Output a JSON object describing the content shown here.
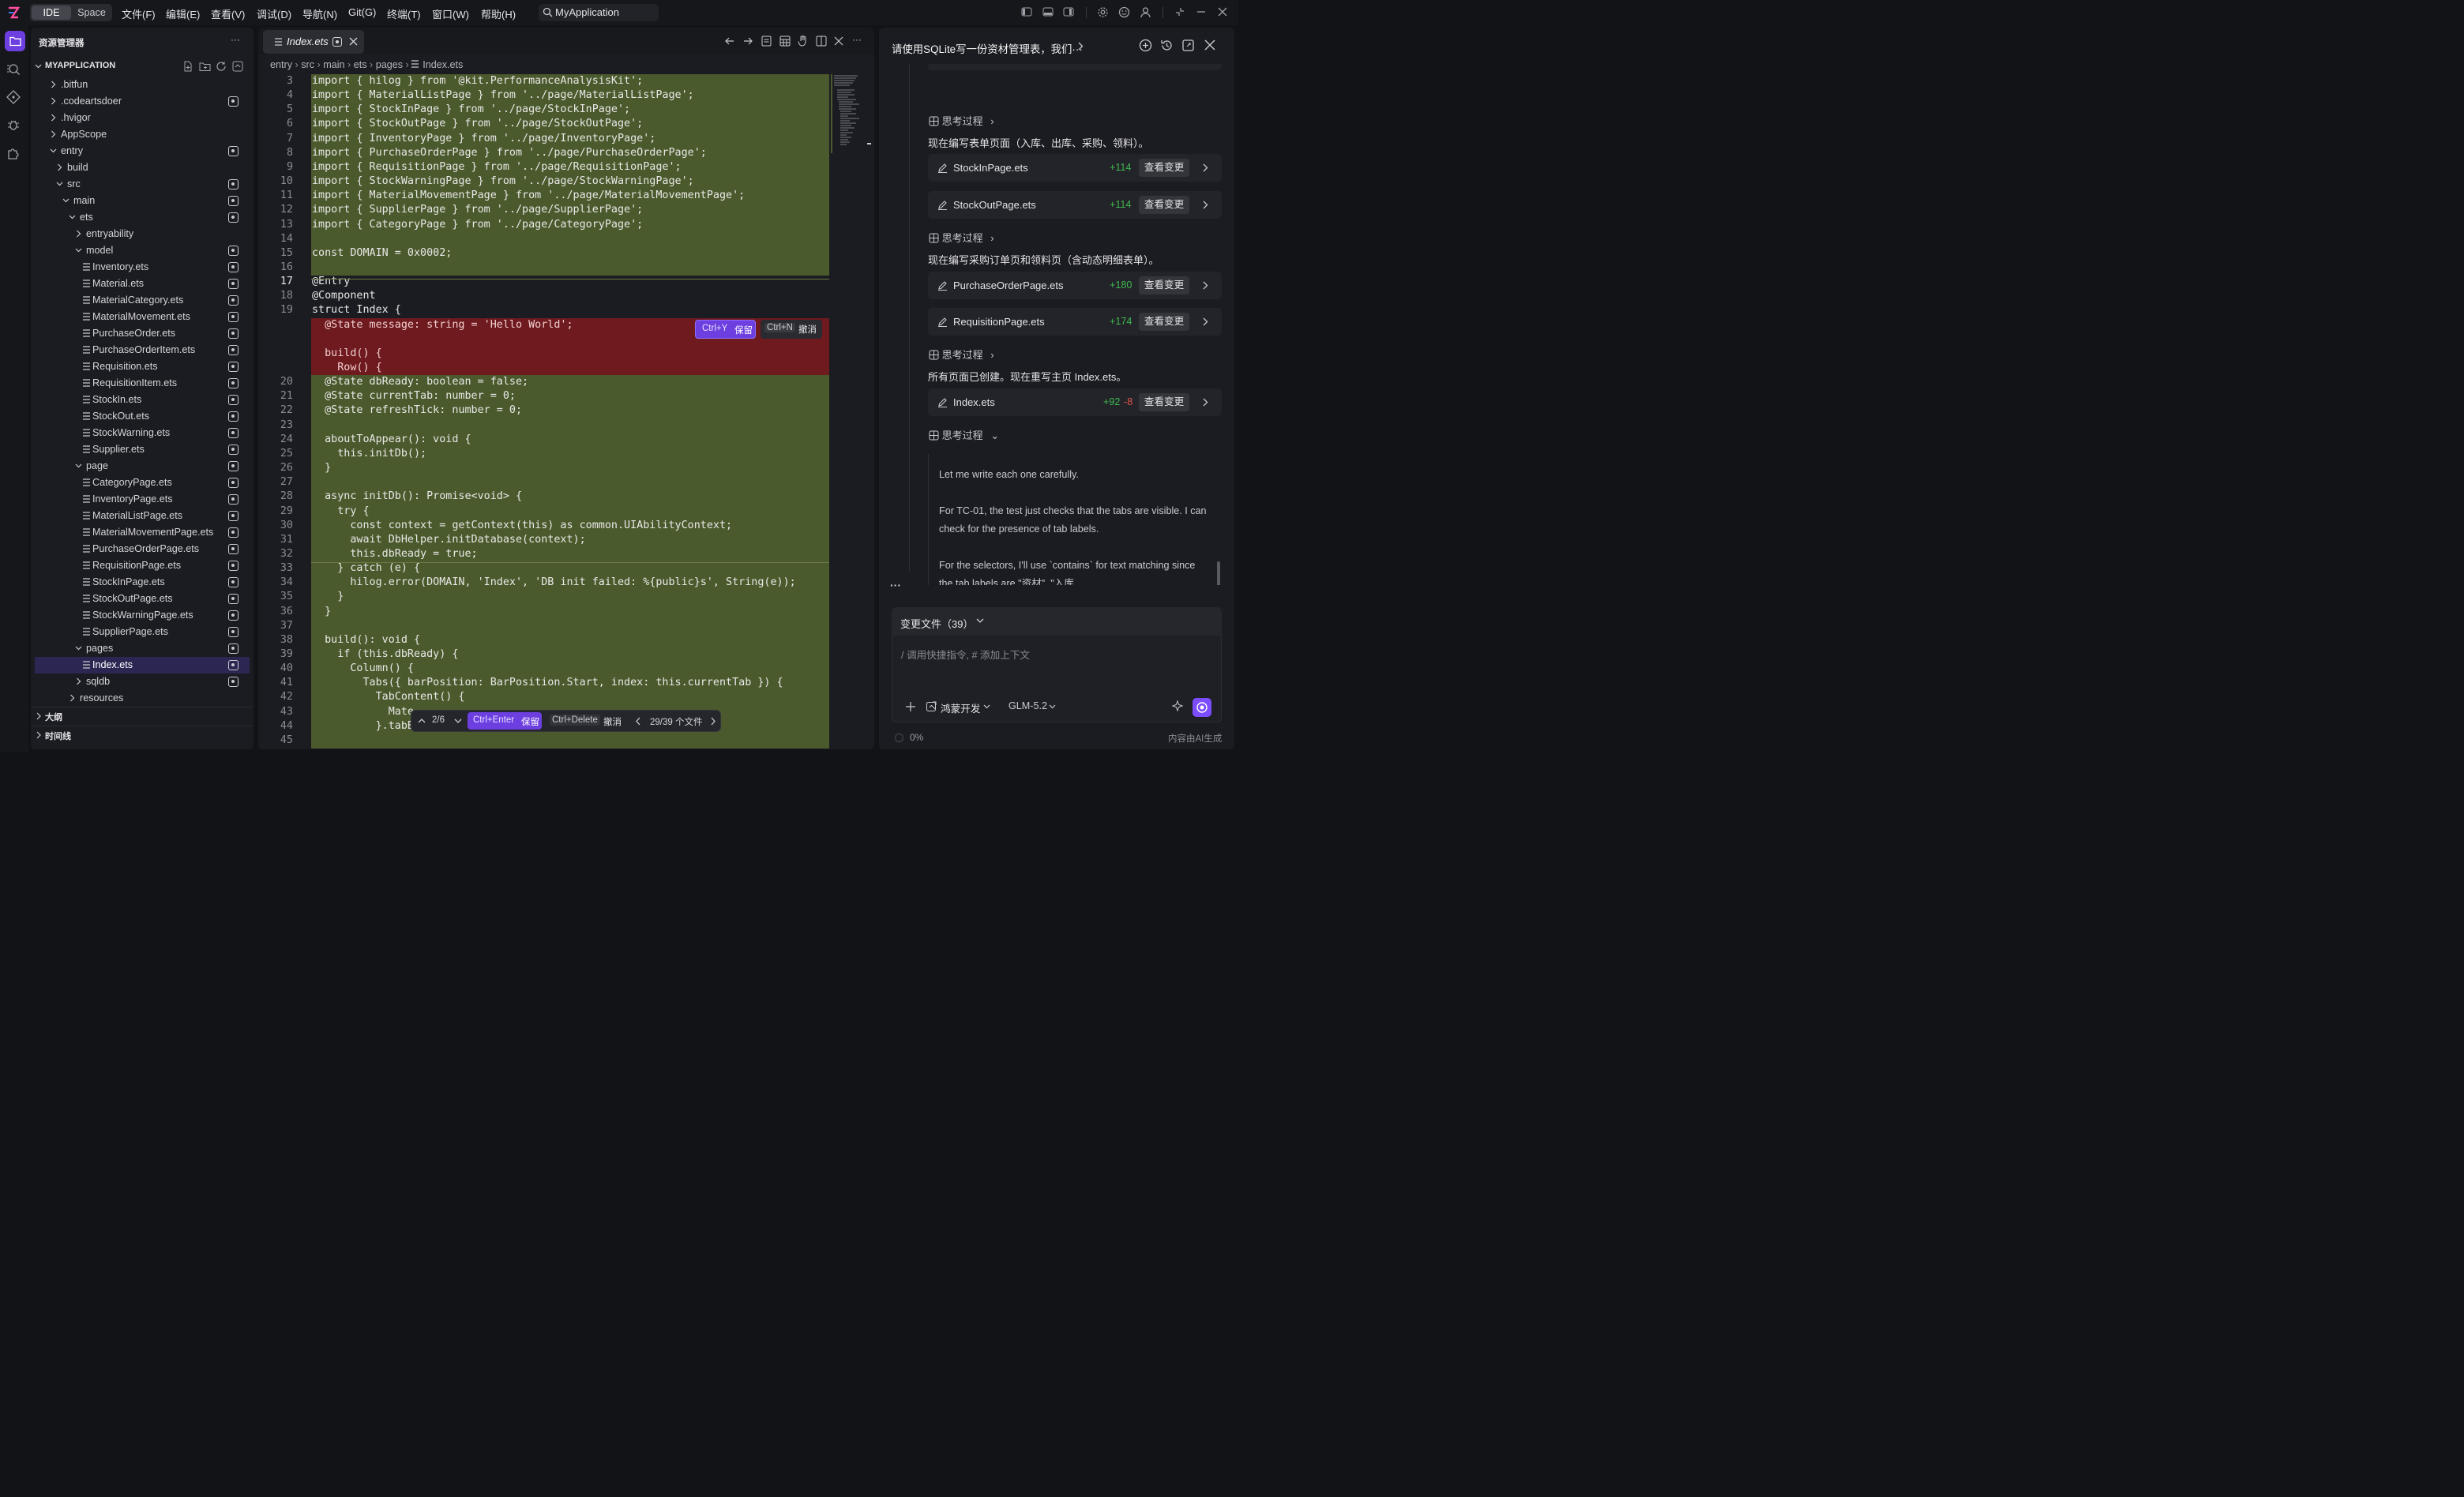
{
  "titlebar": {
    "mode_ide": "IDE",
    "mode_space": "Space",
    "menus": [
      "文件(F)",
      "编辑(E)",
      "查看(V)",
      "调试(D)",
      "导航(N)",
      "Git(G)",
      "终端(T)",
      "窗口(W)",
      "帮助(H)"
    ],
    "search_text": "MyApplication"
  },
  "explorer": {
    "title": "资源管理器",
    "more": "···",
    "project": "MYAPPLICATION",
    "items": [
      {
        "label": ".bitfun",
        "depth": 0,
        "type": "folder",
        "open": false,
        "dot": false
      },
      {
        "label": ".codeartsdoer",
        "depth": 0,
        "type": "folder",
        "open": false,
        "dot": true
      },
      {
        "label": ".hvigor",
        "depth": 0,
        "type": "folder",
        "open": false,
        "dot": false
      },
      {
        "label": "AppScope",
        "depth": 0,
        "type": "folder",
        "open": false,
        "dot": false
      },
      {
        "label": "entry",
        "depth": 0,
        "type": "folder",
        "open": true,
        "dot": true
      },
      {
        "label": "build",
        "depth": 1,
        "type": "folder",
        "open": false,
        "dot": false
      },
      {
        "label": "src",
        "depth": 1,
        "type": "folder",
        "open": true,
        "dot": true
      },
      {
        "label": "main",
        "depth": 2,
        "type": "folder",
        "open": true,
        "dot": true
      },
      {
        "label": "ets",
        "depth": 3,
        "type": "folder",
        "open": true,
        "dot": true
      },
      {
        "label": "entryability",
        "depth": 4,
        "type": "folder",
        "open": false,
        "dot": false
      },
      {
        "label": "model",
        "depth": 4,
        "type": "folder",
        "open": true,
        "dot": true
      },
      {
        "label": "Inventory.ets",
        "depth": 5,
        "type": "file",
        "dot": true
      },
      {
        "label": "Material.ets",
        "depth": 5,
        "type": "file",
        "dot": true
      },
      {
        "label": "MaterialCategory.ets",
        "depth": 5,
        "type": "file",
        "dot": true
      },
      {
        "label": "MaterialMovement.ets",
        "depth": 5,
        "type": "file",
        "dot": true
      },
      {
        "label": "PurchaseOrder.ets",
        "depth": 5,
        "type": "file",
        "dot": true
      },
      {
        "label": "PurchaseOrderItem.ets",
        "depth": 5,
        "type": "file",
        "dot": true
      },
      {
        "label": "Requisition.ets",
        "depth": 5,
        "type": "file",
        "dot": true
      },
      {
        "label": "RequisitionItem.ets",
        "depth": 5,
        "type": "file",
        "dot": true
      },
      {
        "label": "StockIn.ets",
        "depth": 5,
        "type": "file",
        "dot": true
      },
      {
        "label": "StockOut.ets",
        "depth": 5,
        "type": "file",
        "dot": true
      },
      {
        "label": "StockWarning.ets",
        "depth": 5,
        "type": "file",
        "dot": true
      },
      {
        "label": "Supplier.ets",
        "depth": 5,
        "type": "file",
        "dot": true
      },
      {
        "label": "page",
        "depth": 4,
        "type": "folder",
        "open": true,
        "dot": true
      },
      {
        "label": "CategoryPage.ets",
        "depth": 5,
        "type": "file",
        "dot": true
      },
      {
        "label": "InventoryPage.ets",
        "depth": 5,
        "type": "file",
        "dot": true
      },
      {
        "label": "MaterialListPage.ets",
        "depth": 5,
        "type": "file",
        "dot": true
      },
      {
        "label": "MaterialMovementPage.ets",
        "depth": 5,
        "type": "file",
        "dot": true
      },
      {
        "label": "PurchaseOrderPage.ets",
        "depth": 5,
        "type": "file",
        "dot": true
      },
      {
        "label": "RequisitionPage.ets",
        "depth": 5,
        "type": "file",
        "dot": true
      },
      {
        "label": "StockInPage.ets",
        "depth": 5,
        "type": "file",
        "dot": true
      },
      {
        "label": "StockOutPage.ets",
        "depth": 5,
        "type": "file",
        "dot": true
      },
      {
        "label": "StockWarningPage.ets",
        "depth": 5,
        "type": "file",
        "dot": true
      },
      {
        "label": "SupplierPage.ets",
        "depth": 5,
        "type": "file",
        "dot": true
      },
      {
        "label": "pages",
        "depth": 4,
        "type": "folder",
        "open": true,
        "dot": true
      },
      {
        "label": "Index.ets",
        "depth": 5,
        "type": "file",
        "dot": true,
        "selected": true
      },
      {
        "label": "sqldb",
        "depth": 4,
        "type": "folder",
        "open": false,
        "dot": true
      },
      {
        "label": "resources",
        "depth": 3,
        "type": "folder",
        "open": false,
        "dot": false
      }
    ],
    "outline": "大纲",
    "timeline": "时间线"
  },
  "editor": {
    "tab_label": "Index.ets",
    "breadcrumb": [
      "entry",
      "src",
      "main",
      "ets",
      "pages",
      "Index.ets"
    ],
    "lines": [
      {
        "n": "3",
        "t": "import { hilog } from '@kit.PerformanceAnalysisKit';",
        "k": "add"
      },
      {
        "n": "4",
        "t": "import { MaterialListPage } from '../page/MaterialListPage';",
        "k": "add"
      },
      {
        "n": "5",
        "t": "import { StockInPage } from '../page/StockInPage';",
        "k": "add"
      },
      {
        "n": "6",
        "t": "import { StockOutPage } from '../page/StockOutPage';",
        "k": "add"
      },
      {
        "n": "7",
        "t": "import { InventoryPage } from '../page/InventoryPage';",
        "k": "add"
      },
      {
        "n": "8",
        "t": "import { PurchaseOrderPage } from '../page/PurchaseOrderPage';",
        "k": "add"
      },
      {
        "n": "9",
        "t": "import { RequisitionPage } from '../page/RequisitionPage';",
        "k": "add"
      },
      {
        "n": "10",
        "t": "import { StockWarningPage } from '../page/StockWarningPage';",
        "k": "add"
      },
      {
        "n": "11",
        "t": "import { MaterialMovementPage } from '../page/MaterialMovementPage';",
        "k": "add"
      },
      {
        "n": "12",
        "t": "import { SupplierPage } from '../page/SupplierPage';",
        "k": "add"
      },
      {
        "n": "13",
        "t": "import { CategoryPage } from '../page/CategoryPage';",
        "k": "add"
      },
      {
        "n": "14",
        "t": "",
        "k": "add"
      },
      {
        "n": "15",
        "t": "const DOMAIN = 0x0002;",
        "k": "add"
      },
      {
        "n": "16",
        "t": "",
        "k": "add"
      },
      {
        "n": "17",
        "t": "@Entry",
        "k": "ctx"
      },
      {
        "n": "18",
        "t": "@Component",
        "k": "ctx"
      },
      {
        "n": "19",
        "t": "struct Index {",
        "k": "ctx"
      },
      {
        "n": "",
        "t": "  @State message: string = 'Hello World';",
        "k": "del"
      },
      {
        "n": "",
        "t": "",
        "k": "del"
      },
      {
        "n": "",
        "t": "  build() {",
        "k": "del"
      },
      {
        "n": "",
        "t": "    Row() {",
        "k": "del"
      },
      {
        "n": "20",
        "t": "  @State dbReady: boolean = false;",
        "k": "add"
      },
      {
        "n": "21",
        "t": "  @State currentTab: number = 0;",
        "k": "add"
      },
      {
        "n": "22",
        "t": "  @State refreshTick: number = 0;",
        "k": "add"
      },
      {
        "n": "23",
        "t": "",
        "k": "add"
      },
      {
        "n": "24",
        "t": "  aboutToAppear(): void {",
        "k": "add"
      },
      {
        "n": "25",
        "t": "    this.initDb();",
        "k": "add"
      },
      {
        "n": "26",
        "t": "  }",
        "k": "add"
      },
      {
        "n": "27",
        "t": "",
        "k": "add"
      },
      {
        "n": "28",
        "t": "  async initDb(): Promise<void> {",
        "k": "add"
      },
      {
        "n": "29",
        "t": "    try {",
        "k": "add"
      },
      {
        "n": "30",
        "t": "      const context = getContext(this) as common.UIAbilityContext;",
        "k": "add"
      },
      {
        "n": "31",
        "t": "      await DbHelper.initDatabase(context);",
        "k": "add"
      },
      {
        "n": "32",
        "t": "      this.dbReady = true;",
        "k": "add"
      },
      {
        "n": "33",
        "t": "    } catch (e) {",
        "k": "add"
      },
      {
        "n": "34",
        "t": "      hilog.error(DOMAIN, 'Index', 'DB init failed: %{public}s', String(e));",
        "k": "add"
      },
      {
        "n": "35",
        "t": "    }",
        "k": "add"
      },
      {
        "n": "36",
        "t": "  }",
        "k": "add"
      },
      {
        "n": "37",
        "t": "",
        "k": "add"
      },
      {
        "n": "38",
        "t": "  build(): void {",
        "k": "add"
      },
      {
        "n": "39",
        "t": "    if (this.dbReady) {",
        "k": "add"
      },
      {
        "n": "40",
        "t": "      Column() {",
        "k": "add"
      },
      {
        "n": "41",
        "t": "        Tabs({ barPosition: BarPosition.Start, index: this.currentTab }) {",
        "k": "add"
      },
      {
        "n": "42",
        "t": "          TabContent() {",
        "k": "add"
      },
      {
        "n": "43",
        "t": "            Mate",
        "k": "add"
      },
      {
        "n": "44",
        "t": "          }.tabB",
        "k": "add"
      },
      {
        "n": "45",
        "t": "",
        "k": "add"
      }
    ],
    "inline_keep_key": "Ctrl+Y",
    "inline_keep_label": "保留",
    "inline_undo_key": "Ctrl+N",
    "inline_undo_label": "撤消",
    "bottom_counter": "2/6",
    "bottom_keep_key": "Ctrl+Enter",
    "bottom_keep_label": "保留",
    "bottom_undo_key": "Ctrl+Delete",
    "bottom_undo_label": "撤消",
    "bottom_files": "29/39 个文件"
  },
  "chat": {
    "title": "请使用SQLite写一份资材管理表，我们···",
    "think_label": "思考过程",
    "msg1": "现在编写表单页面（入库、出库、采购、领料）。",
    "msg2": "现在编写采购订单页和领料页（含动态明细表单）。",
    "msg3": "所有页面已创建。现在重写主页 Index.ets。",
    "view_change": "查看变更",
    "cards": [
      {
        "name": "StockInPage.ets",
        "add": "+114",
        "del": ""
      },
      {
        "name": "StockOutPage.ets",
        "add": "+114",
        "del": ""
      },
      {
        "name": "PurchaseOrderPage.ets",
        "add": "+180",
        "del": ""
      },
      {
        "name": "RequisitionPage.ets",
        "add": "+174",
        "del": ""
      },
      {
        "name": "Index.ets",
        "add": "+92",
        "del": "-8"
      }
    ],
    "reasoning": [
      "Let me write each one carefully.",
      "For TC-01, the test just checks that the tabs are visible. I can check for the presence of tab labels.",
      "For the selectors, I'll use `contains` for text matching since the tab labels are \"资材\", \"入库"
    ],
    "ellipsis": "···",
    "changed_files": "变更文件（39）",
    "input_placeholder": "/ 调用快捷指令, # 添加上下文",
    "agent_mode": "鸿蒙开发",
    "model": "GLM-5.2",
    "progress": "0%",
    "footer_note": "内容由AI生成"
  },
  "colors": {
    "accent": "#7c4dff",
    "diff_add_bg": "#4b5a2c",
    "diff_del_bg": "#6e1a1f",
    "add_text": "#3fb950",
    "del_text": "#e5534b"
  }
}
